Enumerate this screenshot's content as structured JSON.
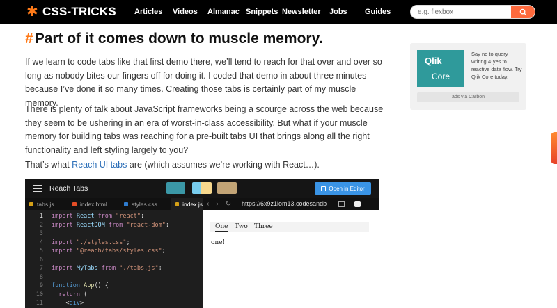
{
  "header": {
    "logo_text": "CSS-TRICKS",
    "nav": [
      "Articles",
      "Videos",
      "Almanac",
      "Snippets",
      "Newsletter",
      "Jobs",
      "Guides"
    ],
    "search_placeholder": "e.g. flexbox"
  },
  "article": {
    "heading_hash": "#",
    "heading": "Part of it comes down to muscle memory.",
    "p1": "If we learn to code tabs like that first demo there, we’ll tend to reach for that over and over so long as nobody bites our fingers off for doing it. I coded that demo in about three minutes because I’ve done it so many times. Creating those tabs is certainly part of my muscle memory.",
    "p2": "There is plenty of talk about JavaScript frameworks being a scourge across the web because they seem to be ushering in an era of worst-in-class accessibility. But what if your muscle memory for building tabs was reaching for a pre-built tabs UI that brings along all the right functionality and left styling largely to you?",
    "p3_pre": "That’s what ",
    "p3_link": "Reach UI tabs",
    "p3_post": " are (which assumes we’re working with React…)."
  },
  "embed": {
    "title": "Reach Tabs",
    "open_button": "Open in Editor",
    "file_tabs": [
      "tabs.js",
      "index.html",
      "styles.css",
      "index.js"
    ],
    "url": "https://6x9z1lom13.codesandb",
    "line_numbers": [
      "1",
      "2",
      "3",
      "4",
      "5",
      "6",
      "7",
      "8",
      "9",
      "10",
      "11"
    ],
    "preview_tabs": [
      "One",
      "Two",
      "Three"
    ],
    "preview_panel": "one!",
    "colors": {
      "swatch1": "#3b98a7",
      "swatch2a": "#78cdee",
      "swatch2b": "#f7d88d",
      "swatch3": "#c2a476",
      "button": "#3a94e6"
    }
  },
  "ad": {
    "brand": "Qlik",
    "product": "Core",
    "text": "Say no to query writing & yes to reactive data flow. Try Qlik Core today.",
    "via": "ads via Carbon"
  }
}
